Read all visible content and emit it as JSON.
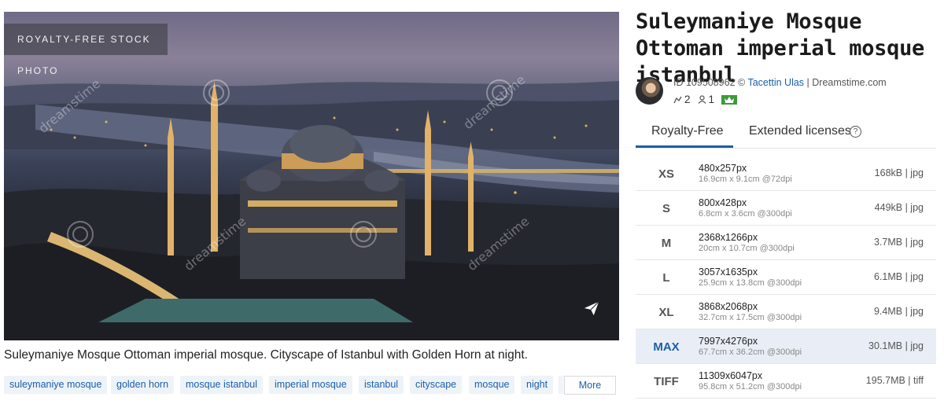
{
  "photo": {
    "badge": "ROYALTY-FREE STOCK PHOTO",
    "watermark": "dreamstime",
    "caption": "Suleymaniye Mosque Ottoman imperial mosque. Cityscape of Istanbul with Golden Horn at night."
  },
  "tags": [
    "suleymaniye mosque",
    "golden horn",
    "mosque istanbul",
    "imperial mosque",
    "istanbul",
    "cityscape",
    "mosque",
    "night"
  ],
  "more_label": "More",
  "title": "Suleymaniye Mosque Ottoman imperial mosque istanbul",
  "meta": {
    "id_prefix": "ID 109508962 ©",
    "author": "Tacettin Ulas",
    "site": "| Dreamstime.com",
    "likes": "2",
    "downloads": "1"
  },
  "tabs": {
    "royalty_free": "Royalty-Free",
    "extended": "Extended licenses",
    "help": "?"
  },
  "sizes": [
    {
      "code": "XS",
      "px": "480x257px",
      "cm": "16.9cm x 9.1cm @72dpi",
      "file": "168kB | jpg"
    },
    {
      "code": "S",
      "px": "800x428px",
      "cm": "6.8cm x 3.6cm @300dpi",
      "file": "449kB | jpg"
    },
    {
      "code": "M",
      "px": "2368x1266px",
      "cm": "20cm x 10.7cm @300dpi",
      "file": "3.7MB | jpg"
    },
    {
      "code": "L",
      "px": "3057x1635px",
      "cm": "25.9cm x 13.8cm @300dpi",
      "file": "6.1MB | jpg"
    },
    {
      "code": "XL",
      "px": "3868x2068px",
      "cm": "32.7cm x 17.5cm @300dpi",
      "file": "9.4MB | jpg"
    },
    {
      "code": "MAX",
      "px": "7997x4276px",
      "cm": "67.7cm x 36.2cm @300dpi",
      "file": "30.1MB | jpg"
    },
    {
      "code": "TIFF",
      "px": "11309x6047px",
      "cm": "95.8cm x 51.2cm @300dpi",
      "file": "195.7MB | tiff"
    }
  ],
  "selected_size": "MAX",
  "colors": {
    "accent": "#1a5fa8",
    "selected_row": "#e9eef6",
    "crown": "#3c9a3a"
  }
}
